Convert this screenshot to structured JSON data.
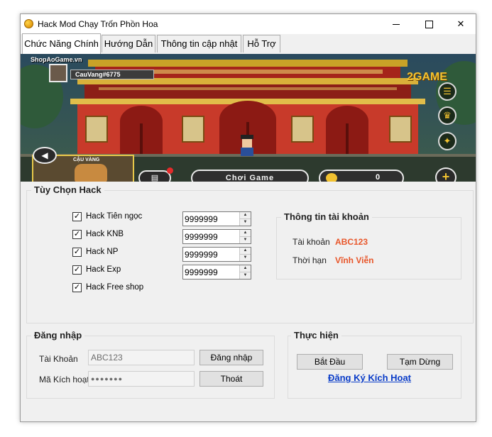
{
  "window": {
    "title": "Hack Mod Chạy Trốn Phồn Hoa",
    "minimize_label": "",
    "maximize_label": "",
    "close_label": "✕"
  },
  "tabs": [
    {
      "label": "Chức Năng Chính",
      "active": true
    },
    {
      "label": "Hướng Dẫn",
      "active": false
    },
    {
      "label": "Thông tin cập nhật",
      "active": false
    },
    {
      "label": "Hỗ Trợ",
      "active": false
    }
  ],
  "banner": {
    "watermark": "ShopAoGame.vn",
    "player_name": "CauVang#6775",
    "brand": "2GAME",
    "pet_name": "CẬU VÀNG",
    "play_button": "Chơi Game",
    "coin_count": "0"
  },
  "hack_options": {
    "title": "Tùy Chọn Hack",
    "items": [
      {
        "label": "Hack Tiên ngọc",
        "checked": true,
        "value": "9999999"
      },
      {
        "label": "Hack KNB",
        "checked": true,
        "value": "9999999"
      },
      {
        "label": "Hack NP",
        "checked": true,
        "value": "9999999"
      },
      {
        "label": "Hack Exp",
        "checked": true,
        "value": "9999999"
      },
      {
        "label": "Hack Free shop",
        "checked": true
      }
    ]
  },
  "account_info": {
    "title": "Thông tin tài khoản",
    "account_label": "Tài khoản",
    "account_value": "ABC123",
    "duration_label": "Thời hạn",
    "duration_value": "Vĩnh Viễn"
  },
  "login": {
    "title": "Đăng nhập",
    "account_label": "Tài Khoản",
    "account_value": "ABC123",
    "code_label": "Mã Kích hoạt",
    "code_value": "●●●●●●●",
    "login_button": "Đăng nhập",
    "exit_button": "Thoát"
  },
  "actions": {
    "title": "Thực hiện",
    "start_button": "Bắt Đầu",
    "pause_button": "Tạm Dừng",
    "register_link": "Đăng Ký Kích Hoạt"
  },
  "colors": {
    "accent_value": "#e8562a",
    "link": "#0a3cc8",
    "window_bg": "#f0f0f0"
  }
}
